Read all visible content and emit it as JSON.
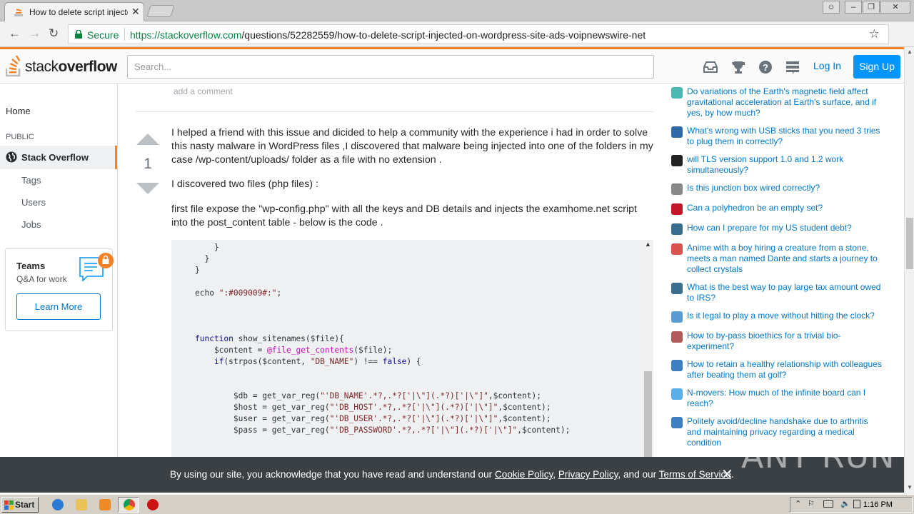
{
  "browser": {
    "tab_title": "How to delete script injected on wordpress site",
    "secure_label": "Secure",
    "url_host": "https://stackoverflow.com",
    "url_path": "/questions/52282559/how-to-delete-script-injected-on-wordpress-site-ads-voipnewswire-net"
  },
  "header": {
    "logo_plain": "stack",
    "logo_bold": "overflow",
    "search_placeholder": "Search...",
    "login": "Log In",
    "signup": "Sign Up"
  },
  "leftnav": {
    "home": "Home",
    "public": "PUBLIC",
    "stackoverflow": "Stack Overflow",
    "tags": "Tags",
    "users": "Users",
    "jobs": "Jobs",
    "teams_title": "Teams",
    "teams_sub": "Q&A for work",
    "teams_button": "Learn More"
  },
  "answer": {
    "add_comment": "add a comment",
    "score": "1",
    "p1": "I helped a friend with this issue and dicided to help a community with the experience i had in order to solve this nasty malware in WordPress files ,I discovered that malware being injected into one of the folders in my case /wp-content/uploads/ folder as a file with no extension .",
    "p2": "I discovered two files (php files) :",
    "p3": "first file expose the \"wp-config.php\" with all the keys and DB details and injects the examhome.net script into the post_content table - below is the code ."
  },
  "hot_questions": [
    {
      "q": "Do variations of the Earth's magnetic field affect gravitational acceleration at Earth's surface, and if yes, by how much?",
      "color": "#4bb9b1"
    },
    {
      "q": "What's wrong with USB sticks that you need 3 tries to plug them in correctly?",
      "color": "#2f6aa8"
    },
    {
      "q": "will TLS version support 1.0 and 1.2 work simultaneously?",
      "color": "#222222"
    },
    {
      "q": "Is this junction box wired correctly?",
      "color": "#888888"
    },
    {
      "q": "Can a polyhedron be an empty set?",
      "color": "#c5172a"
    },
    {
      "q": "How can I prepare for my US student debt?",
      "color": "#3a6e8e"
    },
    {
      "q": "Anime with a boy hiring a creature from a stone, meets a man named Dante and starts a journey to collect crystals",
      "color": "#d9534f"
    },
    {
      "q": "What is the best way to pay large tax amount owed to IRS?",
      "color": "#3a6e8e"
    },
    {
      "q": "Is it legal to play a move without hitting the clock?",
      "color": "#5a9bd4"
    },
    {
      "q": "How to by-pass bioethics for a trivial bio-experiment?",
      "color": "#b35a5a"
    },
    {
      "q": "How to retain a healthy relationship with colleagues after beating them at golf?",
      "color": "#3f7fc1"
    },
    {
      "q": "N-movers: How much of the infinite board can I reach?",
      "color": "#5ab0e6"
    },
    {
      "q": "Politely avoid/decline handshake due to arthritis and maintaining privacy regarding a medical condition",
      "color": "#3f7fc1"
    }
  ],
  "cookie": {
    "pre": "By using our site, you acknowledge that you have read and understand our ",
    "cookie_policy": "Cookie Policy",
    "comma": ", ",
    "privacy_policy": "Privacy Policy",
    "and": ", and our ",
    "terms": "Terms of Service",
    "dot": "."
  },
  "watermark": "ANY RUN",
  "taskbar": {
    "start": "Start",
    "clock": "1:16 PM"
  }
}
